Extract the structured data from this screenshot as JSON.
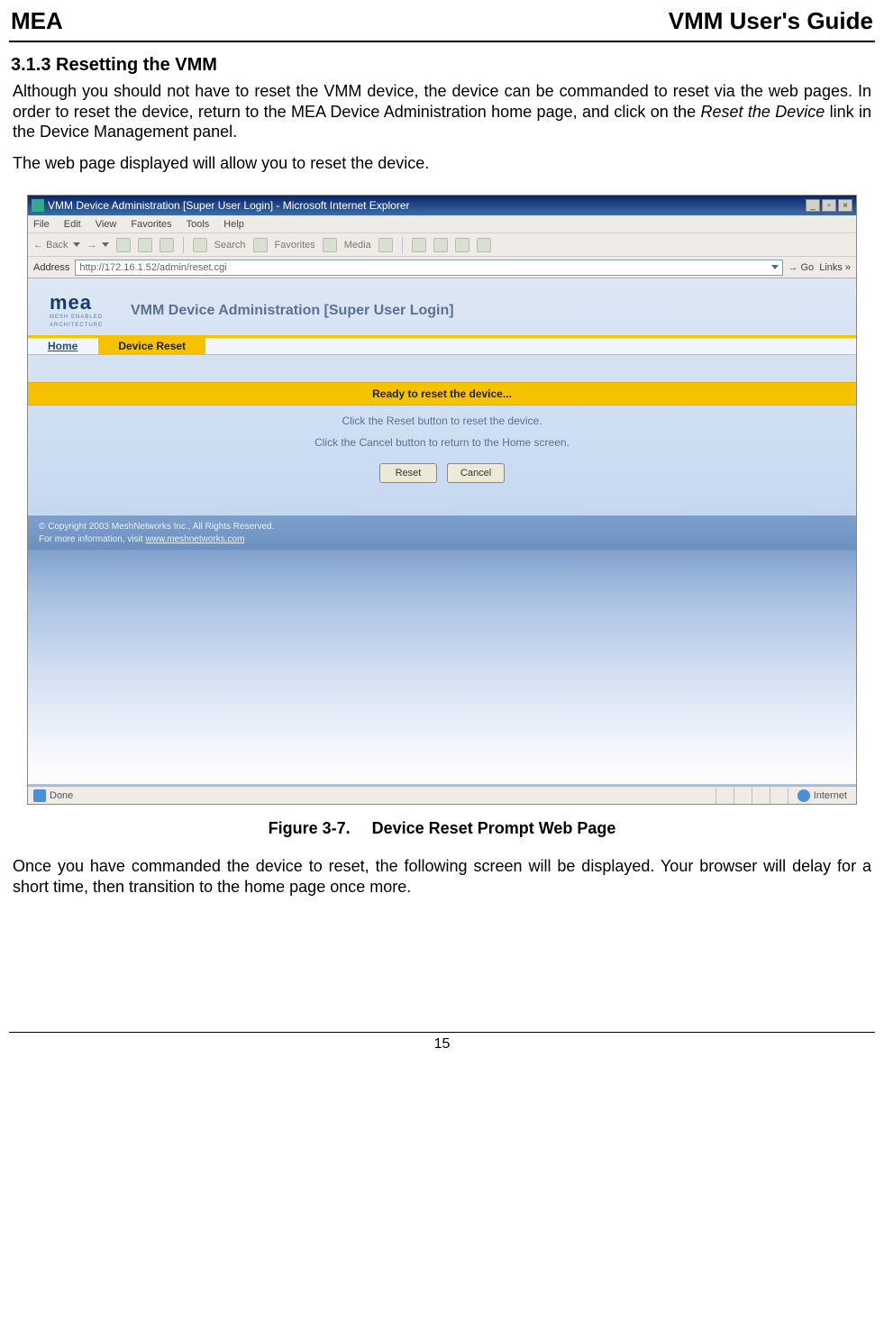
{
  "doc": {
    "header_left": "MEA",
    "header_right": "VMM User's Guide",
    "section_heading": "3.1.3  Resetting the VMM",
    "para1_a": "Although you should not have to reset the VMM device, the device can be commanded to reset via the web pages. In order to reset the device, return to the MEA Device Administration home page, and click on the ",
    "para1_em": "Reset the Device",
    "para1_b": " link in the Device Management panel.",
    "para2": "The web page displayed will allow you to reset the device.",
    "figure_label": "Figure 3-7.",
    "figure_title": "Device Reset Prompt Web Page",
    "para3": "Once you have commanded the device to reset, the following screen will be displayed.  Your browser will delay for a short time, then transition to the home page once more.",
    "page_number": "15"
  },
  "ie": {
    "window_title": "VMM Device Administration [Super User Login] - Microsoft Internet Explorer",
    "menu": [
      "File",
      "Edit",
      "View",
      "Favorites",
      "Tools",
      "Help"
    ],
    "toolbar": {
      "back": "Back",
      "search": "Search",
      "favorites": "Favorites",
      "media": "Media"
    },
    "addr_label": "Address",
    "addr_value": "http://172.16.1.52/admin/reset.cgi",
    "go": "Go",
    "links": "Links",
    "status_done": "Done",
    "status_internet": "Internet",
    "win_buttons": {
      "min": "_",
      "max": "▫",
      "close": "×"
    }
  },
  "page": {
    "logo_big": "mea",
    "logo_small1": "MESH ENABLED",
    "logo_small2": "ARCHITECTURE",
    "title": "VMM Device Administration [Super User Login]",
    "tab_home": "Home",
    "tab_reset": "Device Reset",
    "ready": "Ready to reset the device...",
    "instr1": "Click the Reset button to reset the device.",
    "instr2": "Click the Cancel button to return to the Home screen.",
    "btn_reset": "Reset",
    "btn_cancel": "Cancel",
    "copyright": "© Copyright 2003 MeshNetworks Inc., All Rights Reserved.",
    "moreinfo_a": "For more information, visit ",
    "moreinfo_link": "www.meshnetworks.com"
  }
}
